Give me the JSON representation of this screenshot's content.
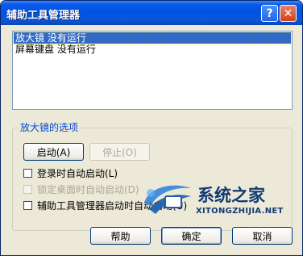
{
  "window": {
    "title": "辅助工具管理器"
  },
  "titlebar": {
    "help_glyph": "?",
    "close_glyph": "✕"
  },
  "list": {
    "items": [
      {
        "label": "放大镜 没有运行",
        "selected": true
      },
      {
        "label": "屏幕键盘 没有运行",
        "selected": false
      }
    ]
  },
  "options": {
    "group_label": "放大镜的选项",
    "start_label": "启动(A)",
    "stop_label": "停止(O)",
    "checkboxes": [
      {
        "label": "登录时自动启动(L)",
        "checked": false,
        "enabled": true
      },
      {
        "label": "锁定桌面时自动启动(D)",
        "checked": false,
        "enabled": false
      },
      {
        "label": "辅助工具管理器启动时自动启动(U)",
        "checked": false,
        "enabled": true
      }
    ]
  },
  "footer": {
    "help_label": "帮助",
    "ok_label": "确定",
    "cancel_label": "取消"
  },
  "watermark": {
    "title": "系统之家",
    "url": "XITONGZHIJIA.NET"
  }
}
